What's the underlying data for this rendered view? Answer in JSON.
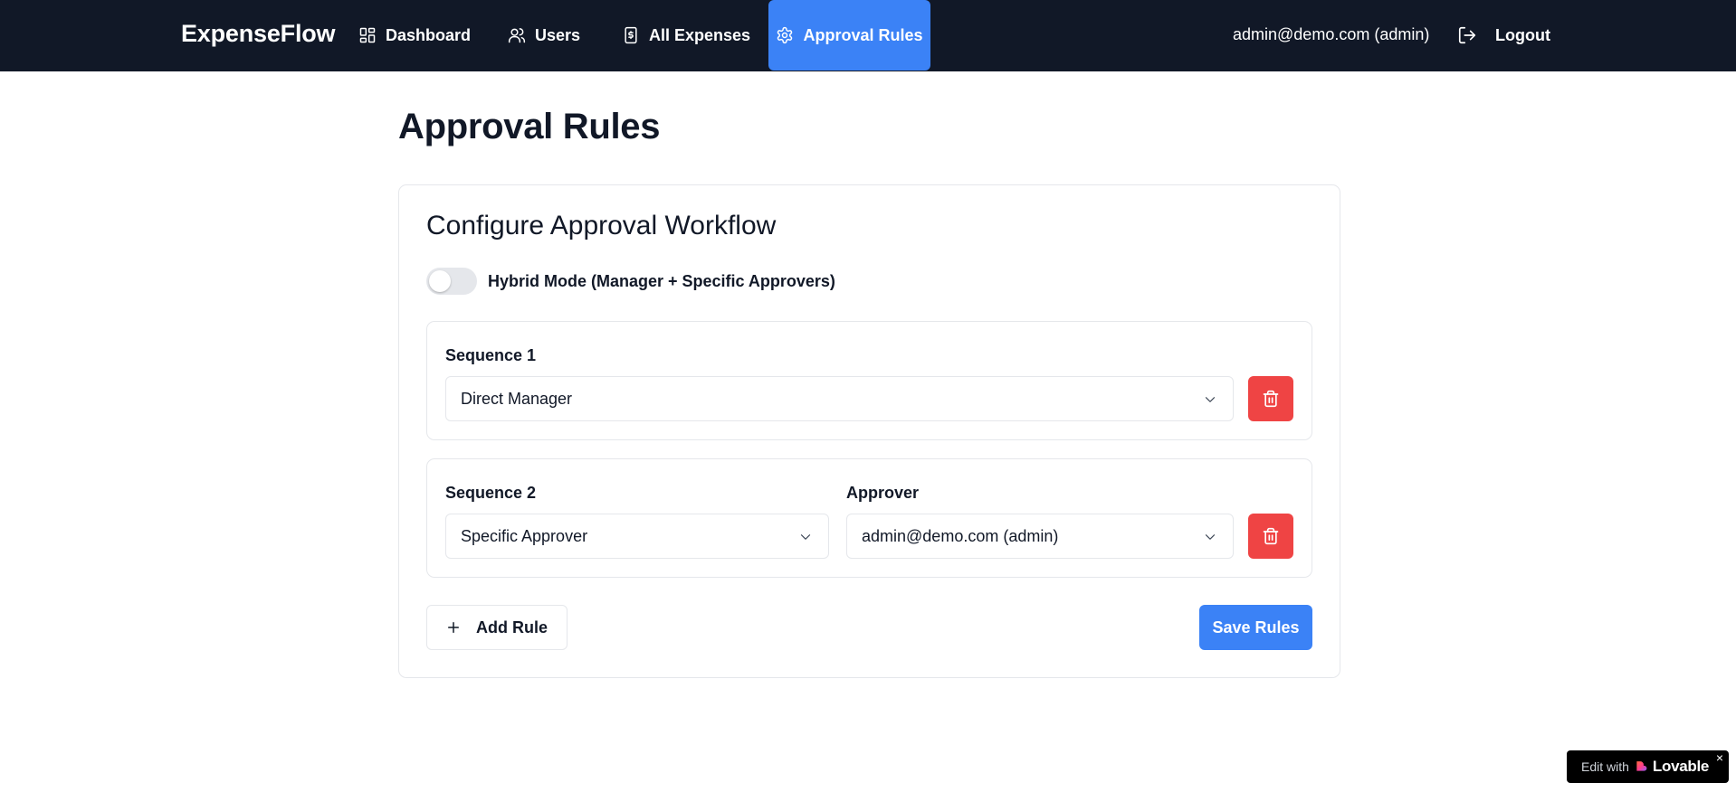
{
  "nav": {
    "brand": "ExpenseFlow",
    "links": [
      {
        "label": "Dashboard",
        "icon": "dashboard-icon"
      },
      {
        "label": "Users",
        "icon": "users-icon"
      },
      {
        "label": "All Expenses",
        "icon": "receipt-icon"
      },
      {
        "label": "Approval Rules",
        "icon": "gear-icon",
        "active": true
      }
    ],
    "user": "admin@demo.com (admin)",
    "logout_label": "Logout",
    "active_color": "#3b82f6",
    "bg_color": "#111827"
  },
  "page": {
    "title": "Approval Rules"
  },
  "card": {
    "title": "Configure Approval Workflow",
    "hybrid_toggle": {
      "label": "Hybrid Mode (Manager + Specific Approvers)",
      "on": false
    },
    "rules": [
      {
        "sequence_label": "Sequence 1",
        "type_value": "Direct Manager"
      },
      {
        "sequence_label": "Sequence 2",
        "type_value": "Specific Approver",
        "approver_label": "Approver",
        "approver_value": "admin@demo.com (admin)"
      }
    ],
    "add_rule_label": "Add Rule",
    "save_label": "Save Rules",
    "delete_color": "#ef4444"
  },
  "badge": {
    "prefix": "Edit with",
    "brand": "Lovable",
    "close": "×"
  }
}
